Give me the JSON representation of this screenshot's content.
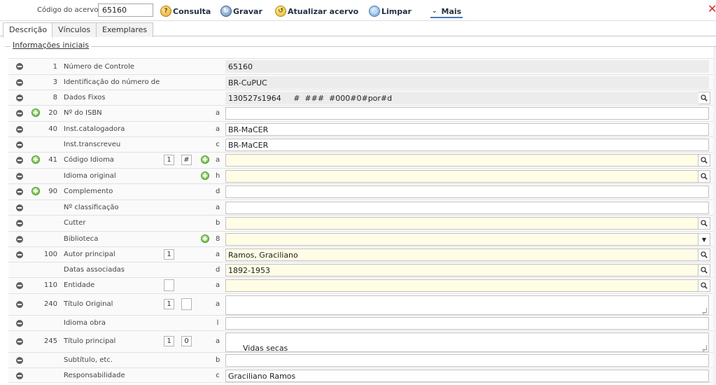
{
  "toolbar": {
    "codigo_label": "Código do acervo:",
    "codigo_value": "65160",
    "consulta": "Consulta",
    "gravar": "Gravar",
    "atualizar": "Atualizar acervo",
    "limpar": "Limpar",
    "mais": "Mais"
  },
  "tabs": [
    "Descrição",
    "Vínculos",
    "Exemplares"
  ],
  "section_title": "Informações iniciais",
  "rows": [
    {
      "tag": "1",
      "label": "Número de Controle",
      "sub": "",
      "value": "65160"
    },
    {
      "tag": "3",
      "label": "Identificação do número de",
      "sub": "",
      "value": "BR-CuPUC"
    },
    {
      "tag": "8",
      "label": "Dados Fixos",
      "sub": "",
      "value": "130527s1964     #  ###  #000#0#por#d"
    },
    {
      "tag": "20",
      "label": "Nº do ISBN",
      "sub": "a",
      "value": ""
    },
    {
      "tag": "40",
      "label": "Inst.catalogadora",
      "sub": "a",
      "value": "BR-MaCER"
    },
    {
      "tag": "",
      "label": "Inst.transcreveu",
      "sub": "c",
      "value": "BR-MaCER"
    },
    {
      "tag": "41",
      "label": "Código Idioma",
      "sub": "a",
      "value": "",
      "ind1": "1",
      "ind2": "#"
    },
    {
      "tag": "",
      "label": "Idioma original",
      "sub": "h",
      "value": ""
    },
    {
      "tag": "90",
      "label": "Complemento",
      "sub": "d",
      "value": ""
    },
    {
      "tag": "",
      "label": "Nº classificação",
      "sub": "a",
      "value": ""
    },
    {
      "tag": "",
      "label": "Cutter",
      "sub": "b",
      "value": ""
    },
    {
      "tag": "",
      "label": "Biblioteca",
      "sub": "8",
      "value": ""
    },
    {
      "tag": "100",
      "label": "Autor principal",
      "sub": "a",
      "value": "Ramos, Graciliano",
      "ind1": "1"
    },
    {
      "tag": "",
      "label": "Datas associadas",
      "sub": "d",
      "value": "1892-1953"
    },
    {
      "tag": "110",
      "label": "Entidade",
      "sub": "a",
      "value": "",
      "ind1": ""
    },
    {
      "tag": "240",
      "label": "Título Original",
      "sub": "a",
      "value": "",
      "ind1": "1",
      "ind2": ""
    },
    {
      "tag": "",
      "label": "Idioma obra",
      "sub": "l",
      "value": ""
    },
    {
      "tag": "245",
      "label": "Título principal",
      "sub": "a",
      "value": "Vidas secas",
      "ind1": "1",
      "ind2": "0"
    },
    {
      "tag": "",
      "label": "Subtítulo, etc.",
      "sub": "b",
      "value": ""
    },
    {
      "tag": "",
      "label": "Responsabilidade",
      "sub": "c",
      "value": "Graciliano Ramos"
    }
  ]
}
